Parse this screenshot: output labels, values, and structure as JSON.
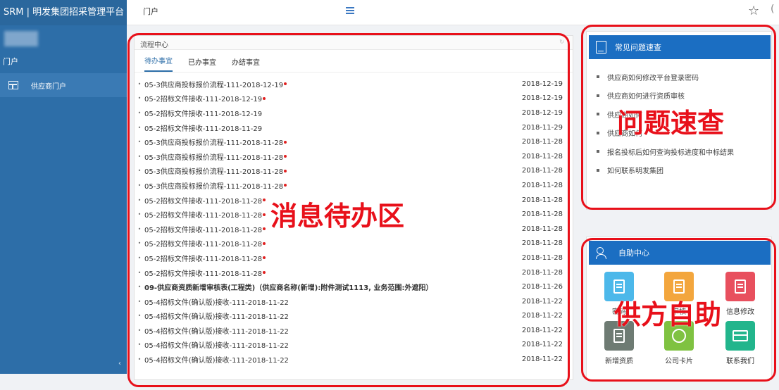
{
  "sidebar": {
    "title": "SRM | 明发集团招采管理平台",
    "section": "门户",
    "item": "供应商门户",
    "collapse": "‹"
  },
  "topbar": {
    "title": "门户",
    "star": "☆",
    "user": "("
  },
  "flow": {
    "header": "流程中心",
    "refresh": "↻",
    "tabs": [
      "待办事宜",
      "已办事宜",
      "办结事宜"
    ],
    "rows": [
      {
        "text": "05-3供应商投标报价流程-111-2018-12-19",
        "dot": true,
        "date": "2018-12-19",
        "bold": false
      },
      {
        "text": "05-2招标文件接收-111-2018-12-19",
        "dot": true,
        "date": "2018-12-19",
        "bold": false
      },
      {
        "text": "05-2招标文件接收-111-2018-12-19",
        "dot": false,
        "date": "2018-12-19",
        "bold": false
      },
      {
        "text": "05-2招标文件接收-111-2018-11-29",
        "dot": false,
        "date": "2018-11-29",
        "bold": false
      },
      {
        "text": "05-3供应商投标报价流程-111-2018-11-28",
        "dot": true,
        "date": "2018-11-28",
        "bold": false
      },
      {
        "text": "05-3供应商投标报价流程-111-2018-11-28",
        "dot": true,
        "date": "2018-11-28",
        "bold": false
      },
      {
        "text": "05-3供应商投标报价流程-111-2018-11-28",
        "dot": true,
        "date": "2018-11-28",
        "bold": false
      },
      {
        "text": "05-3供应商投标报价流程-111-2018-11-28",
        "dot": true,
        "date": "2018-11-28",
        "bold": false
      },
      {
        "text": "05-2招标文件接收-111-2018-11-28",
        "dot": true,
        "date": "2018-11-28",
        "bold": false
      },
      {
        "text": "05-2招标文件接收-111-2018-11-28",
        "dot": true,
        "date": "2018-11-28",
        "bold": false
      },
      {
        "text": "05-2招标文件接收-111-2018-11-28",
        "dot": true,
        "date": "2018-11-28",
        "bold": false
      },
      {
        "text": "05-2招标文件接收-111-2018-11-28",
        "dot": true,
        "date": "2018-11-28",
        "bold": false
      },
      {
        "text": "05-2招标文件接收-111-2018-11-28",
        "dot": true,
        "date": "2018-11-28",
        "bold": false
      },
      {
        "text": "05-2招标文件接收-111-2018-11-28",
        "dot": true,
        "date": "2018-11-28",
        "bold": false
      },
      {
        "text": "09-供应商资质新增审核表(工程类)（供应商名称(新增):附件测试1113, 业务范围:外遮阳）",
        "dot": false,
        "date": "2018-11-26",
        "bold": true
      },
      {
        "text": "05-4招标文件(确认版)接收-111-2018-11-22",
        "dot": false,
        "date": "2018-11-22",
        "bold": false
      },
      {
        "text": "05-4招标文件(确认版)接收-111-2018-11-22",
        "dot": false,
        "date": "2018-11-22",
        "bold": false
      },
      {
        "text": "05-4招标文件(确认版)接收-111-2018-11-22",
        "dot": false,
        "date": "2018-11-22",
        "bold": false
      },
      {
        "text": "05-4招标文件(确认版)接收-111-2018-11-22",
        "dot": false,
        "date": "2018-11-22",
        "bold": false
      },
      {
        "text": "05-4招标文件(确认版)接收-111-2018-11-22",
        "dot": false,
        "date": "2018-11-22",
        "bold": false
      }
    ]
  },
  "faq": {
    "title": "常见问题速查",
    "items": [
      "供应商如何修改平台登录密码",
      "供应商如何进行资质审核",
      "供应商如何",
      "供应商如何",
      "报名投标后如何查询投标进度和中标结果",
      "如何联系明发集团"
    ]
  },
  "self_service": {
    "title": "自助中心",
    "tiles": [
      {
        "label": "密码",
        "color": "#4cb8ea",
        "icon": "doc"
      },
      {
        "label": "审核",
        "color": "#f3a63d",
        "icon": "doc"
      },
      {
        "label": "信息修改",
        "color": "#e8505e",
        "icon": "doc"
      },
      {
        "label": "新增资质",
        "color": "#6e7b73",
        "icon": "doc"
      },
      {
        "label": "公司卡片",
        "color": "#7fc241",
        "icon": "circ"
      },
      {
        "label": "联系我们",
        "color": "#22b58c",
        "icon": "card"
      }
    ]
  },
  "annotations": {
    "flow_label": "消息待办区",
    "faq_label": "问题速查",
    "self_label": "供方自助",
    "color": "#e8101a"
  }
}
